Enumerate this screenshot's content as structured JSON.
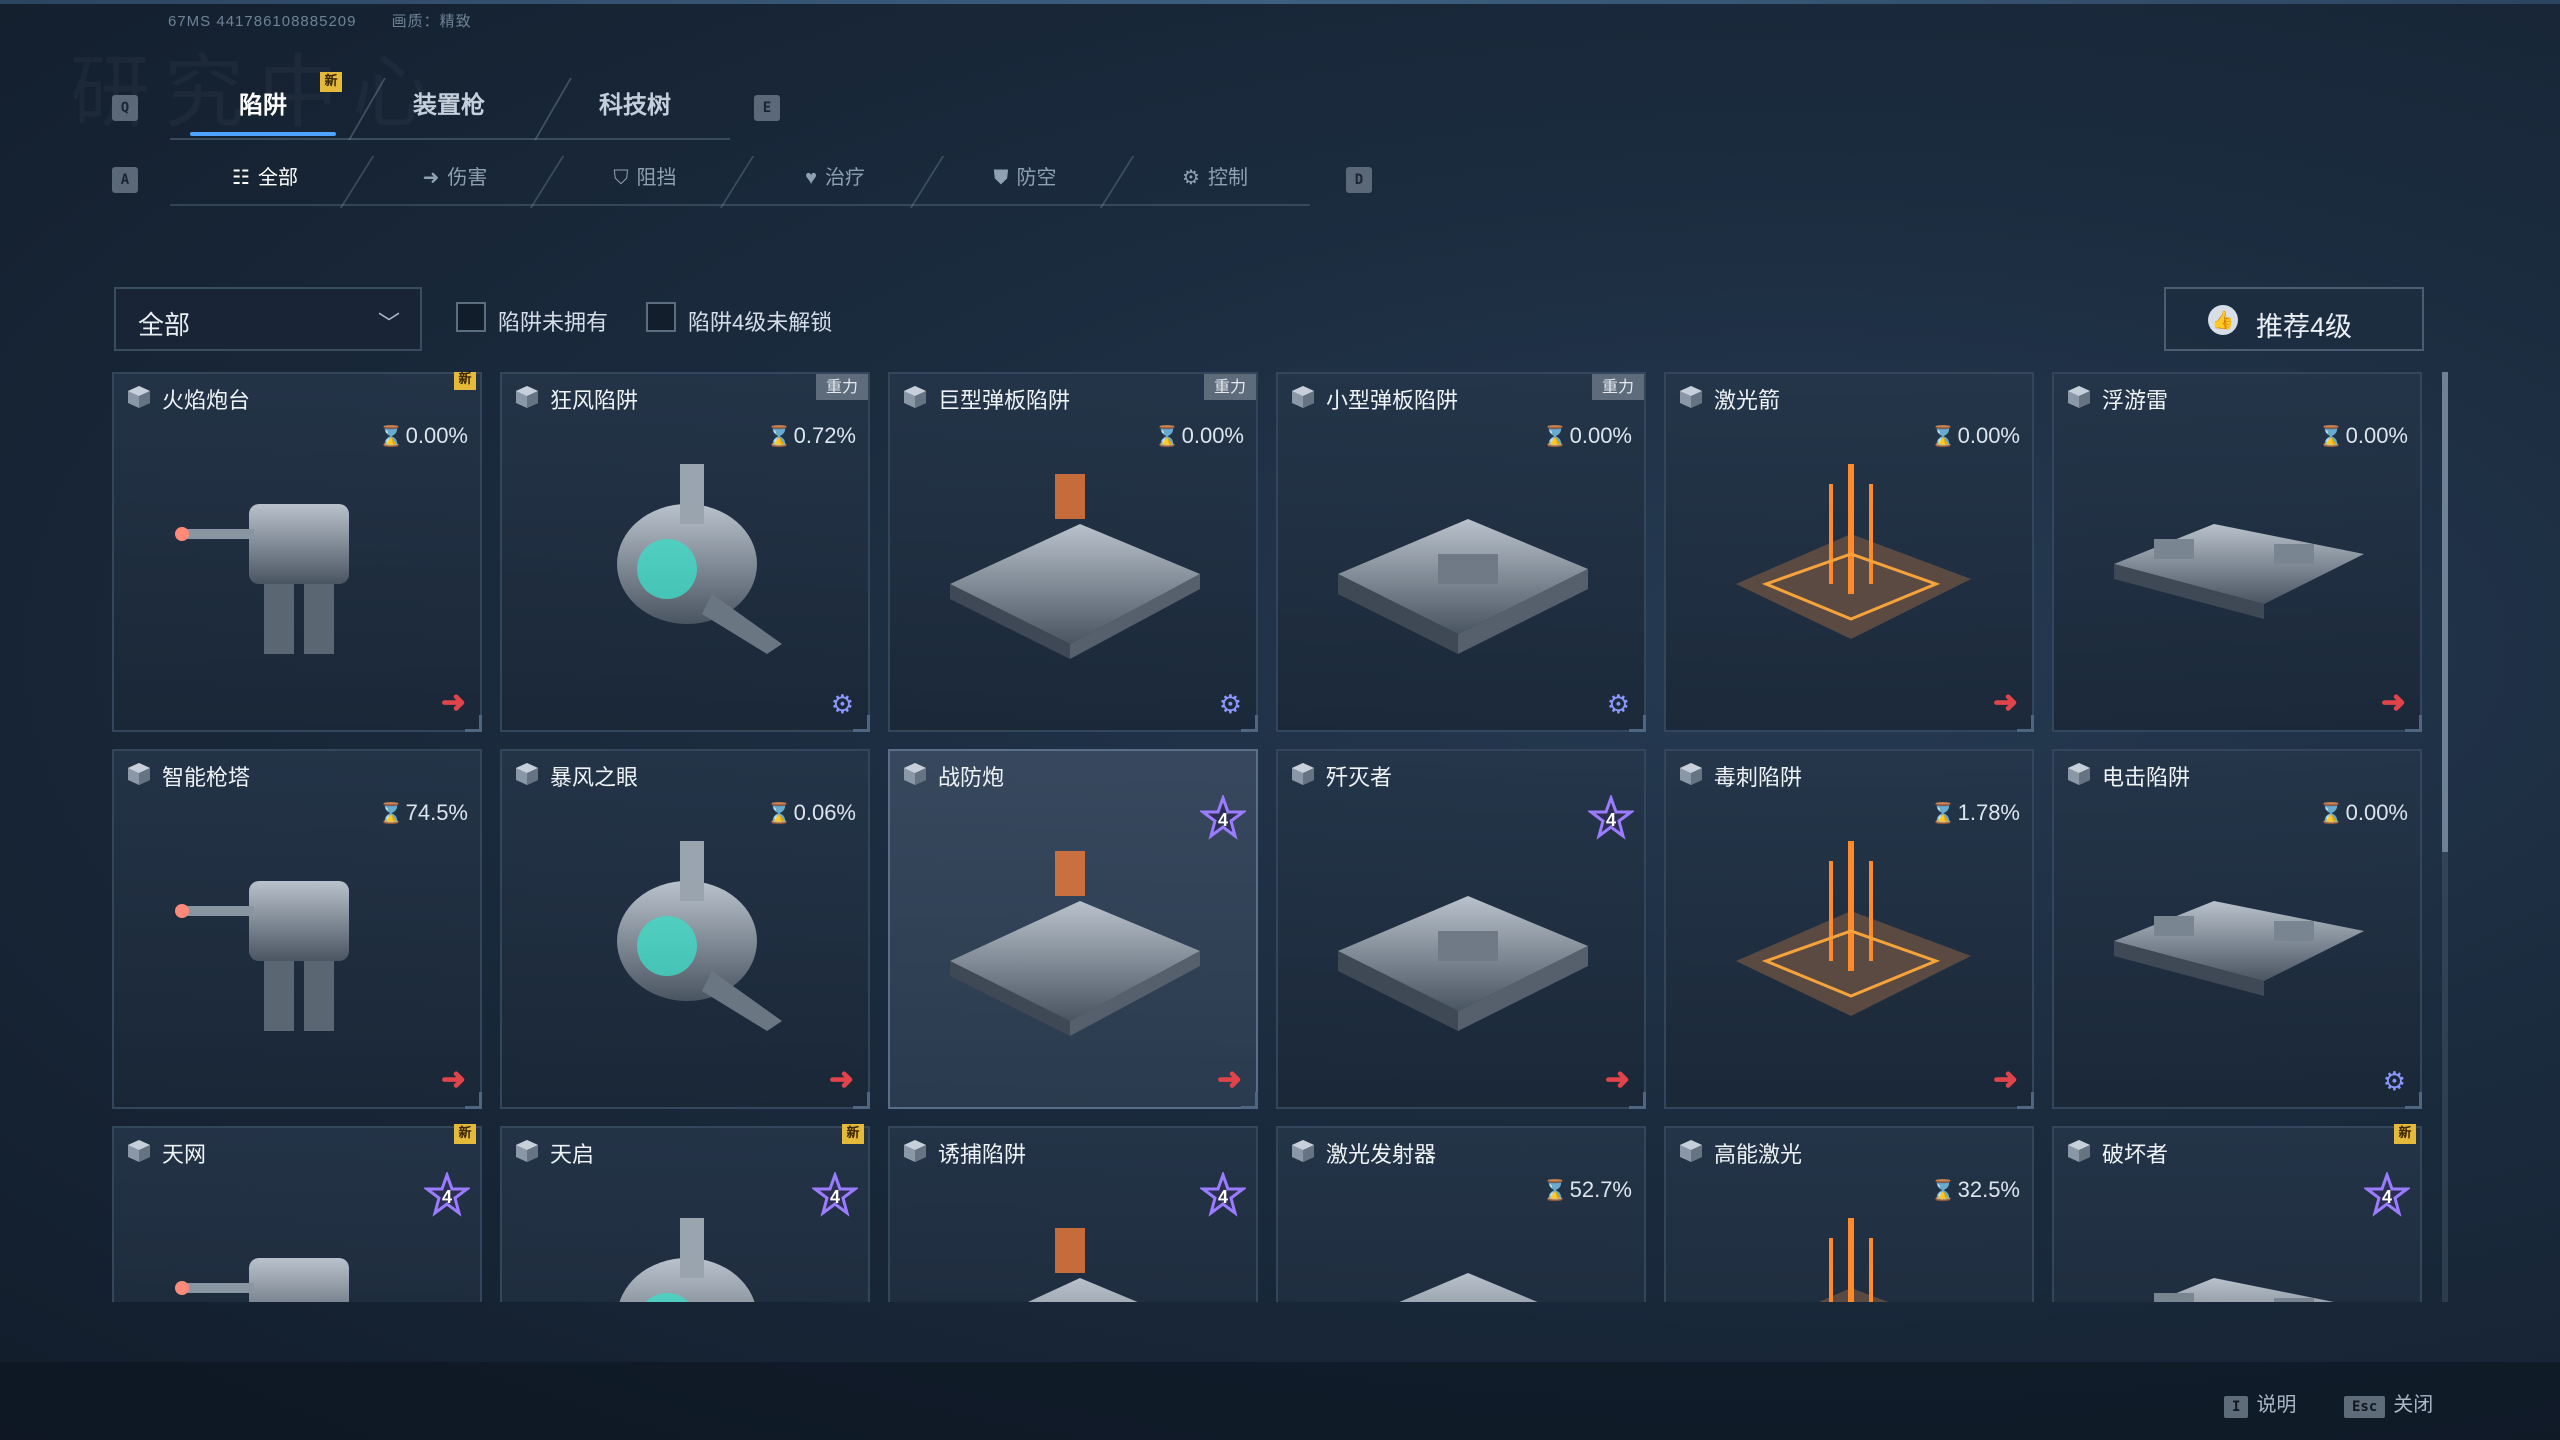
{
  "top_info": {
    "code": "67MS  441786108885209",
    "quality": "画质：精致"
  },
  "watermark": "研究中心",
  "keys": {
    "prev_tab": "Q",
    "next_tab": "E",
    "prev_filter": "A",
    "next_filter": "D"
  },
  "tabs": [
    {
      "label": "陷阱",
      "active": true,
      "badge": "新"
    },
    {
      "label": "装置枪",
      "active": false
    },
    {
      "label": "科技树",
      "active": false
    }
  ],
  "filters": [
    {
      "label": "全部",
      "icon": "list-icon",
      "active": true
    },
    {
      "label": "伤害",
      "icon": "arrow-icon"
    },
    {
      "label": "阻挡",
      "icon": "shield-icon"
    },
    {
      "label": "治疗",
      "icon": "heart-icon"
    },
    {
      "label": "防空",
      "icon": "shield-plane-icon"
    },
    {
      "label": "控制",
      "icon": "gear-icon"
    }
  ],
  "dropdown": {
    "value": "全部"
  },
  "checkboxes": [
    {
      "label": "陷阱未拥有",
      "checked": false
    },
    {
      "label": "陷阱4级未解锁",
      "checked": false
    }
  ],
  "recommend_button": {
    "label": "推荐4级"
  },
  "colors": {
    "accent": "#4da3ff",
    "new_badge": "#e5b93a",
    "arrow": "#e0444a",
    "gear": "#8b97ff",
    "star": "#9b7cff"
  },
  "cards": [
    {
      "name": "火焰炮台",
      "progress": "0.00%",
      "badge": "新",
      "action": "arrow",
      "art": "turret-icon"
    },
    {
      "name": "狂风陷阱",
      "progress": "0.72%",
      "tag": "重力",
      "action": "gear",
      "art": "fan-trap-icon"
    },
    {
      "name": "巨型弹板陷阱",
      "progress": "0.00%",
      "tag": "重力",
      "action": "gear",
      "art": "launch-pad-icon"
    },
    {
      "name": "小型弹板陷阱",
      "progress": "0.00%",
      "tag": "重力",
      "action": "gear",
      "art": "small-pad-icon"
    },
    {
      "name": "激光箭",
      "progress": "0.00%",
      "action": "arrow",
      "art": "laser-arrow-icon"
    },
    {
      "name": "浮游雷",
      "progress": "0.00%",
      "action": "arrow",
      "art": "floating-mine-icon"
    },
    {
      "name": "智能枪塔",
      "progress": "74.5%",
      "action": "arrow",
      "art": "smart-turret-icon"
    },
    {
      "name": "暴风之眼",
      "progress": "0.06%",
      "action": "arrow",
      "art": "storm-eye-icon"
    },
    {
      "name": "战防炮",
      "star": "4",
      "action": "arrow",
      "art": "cannon-icon",
      "selected": true
    },
    {
      "name": "歼灭者",
      "star": "4",
      "action": "arrow",
      "art": "annihilator-icon"
    },
    {
      "name": "毒刺陷阱",
      "progress": "1.78%",
      "action": "arrow",
      "art": "spike-trap-icon"
    },
    {
      "name": "电击陷阱",
      "progress": "0.00%",
      "action": "gear",
      "art": "shock-trap-icon"
    },
    {
      "name": "天网",
      "star": "4",
      "badge": "新",
      "art": "skynet-icon"
    },
    {
      "name": "天启",
      "star": "4",
      "badge": "新",
      "art": "apocalypse-icon"
    },
    {
      "name": "诱捕陷阱",
      "star": "4",
      "art": "lure-trap-icon"
    },
    {
      "name": "激光发射器",
      "progress": "52.7%",
      "art": "laser-launcher-icon"
    },
    {
      "name": "高能激光",
      "progress": "32.5%",
      "art": "high-laser-icon"
    },
    {
      "name": "破坏者",
      "star": "4",
      "badge": "新",
      "art": "destroyer-icon"
    }
  ],
  "hints": [
    {
      "key": "I",
      "label": "说明"
    },
    {
      "key": "Esc",
      "label": "关闭"
    }
  ]
}
